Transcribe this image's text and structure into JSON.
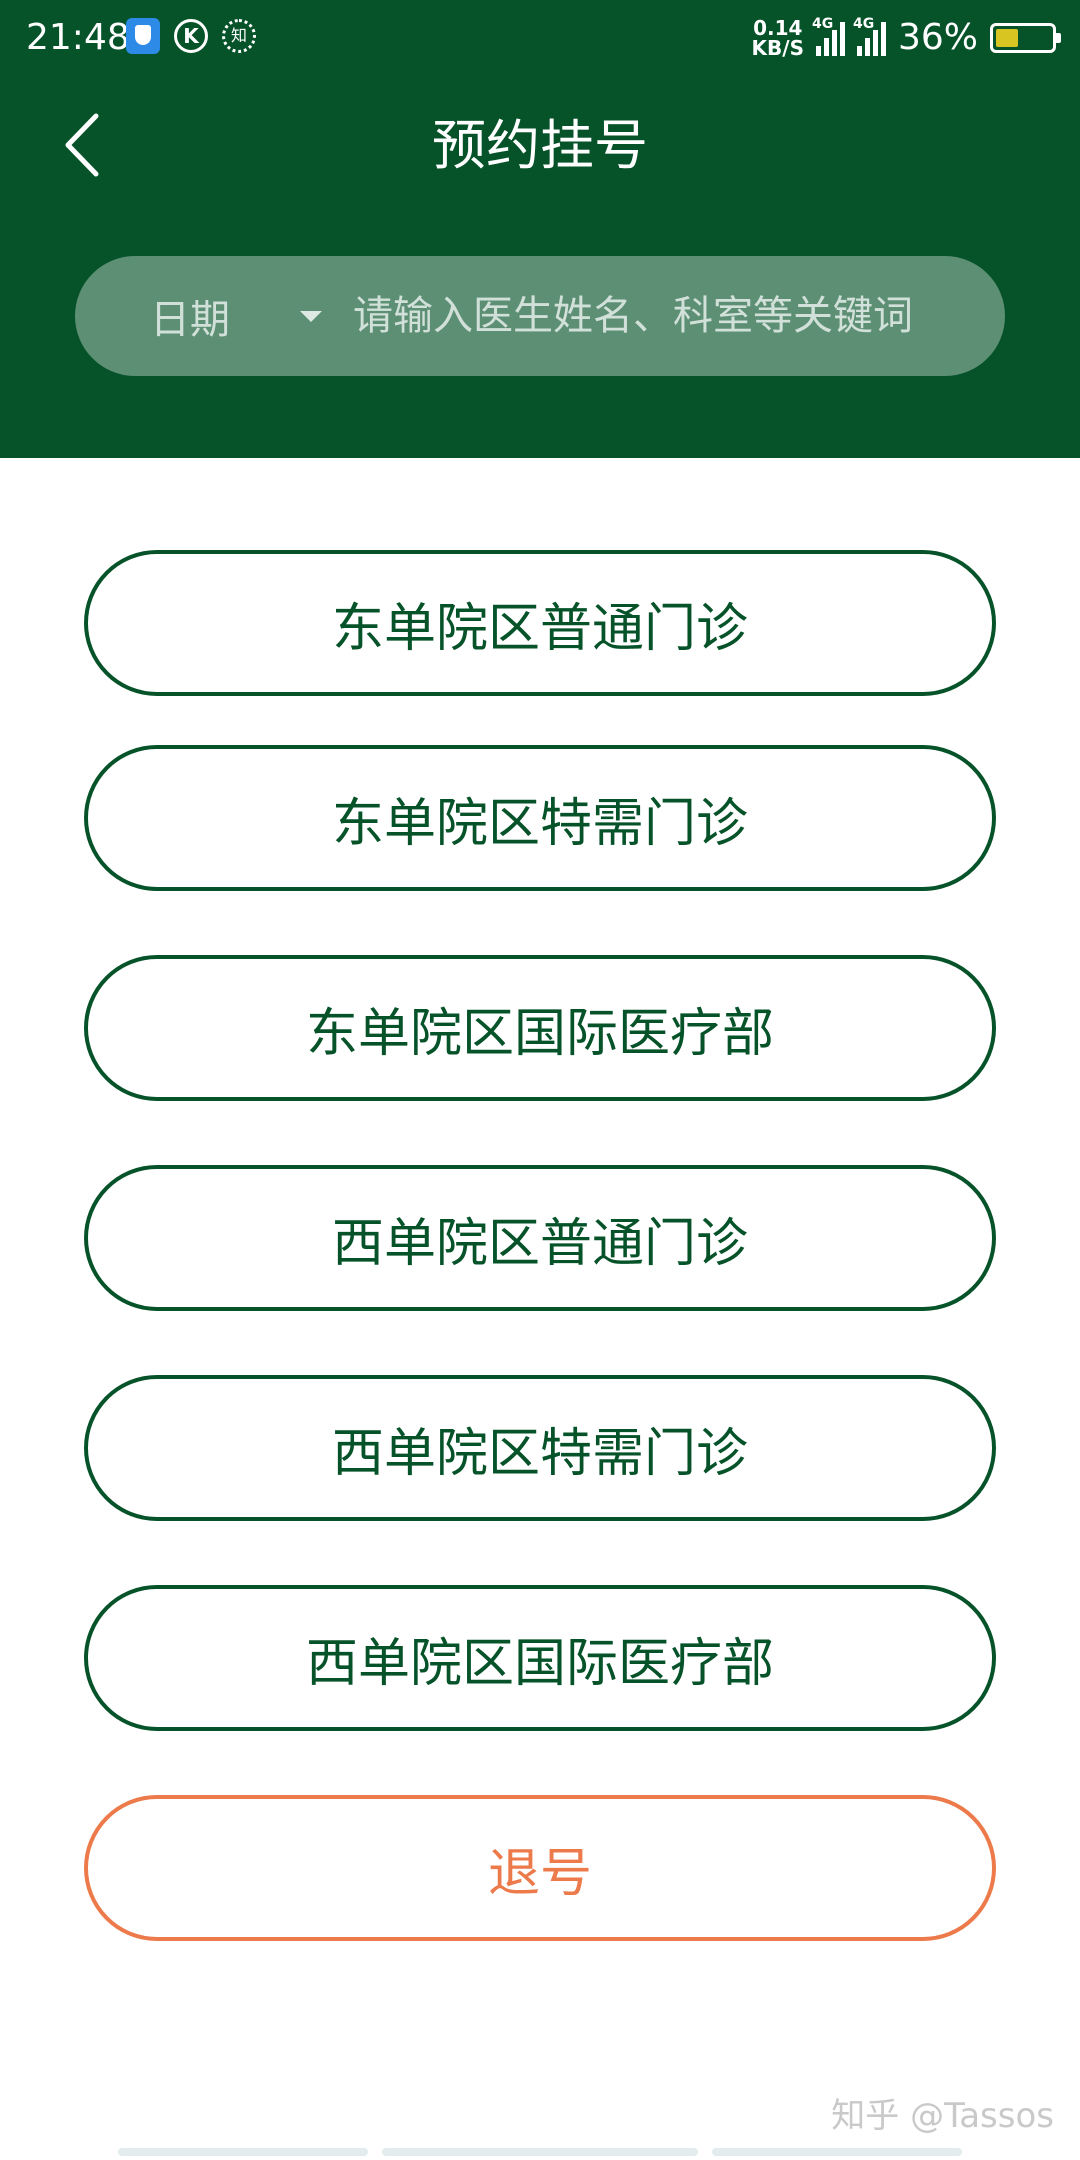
{
  "status_bar": {
    "time": "21:48",
    "net_speed_value": "0.14",
    "net_speed_unit": "KB/S",
    "signal_label_1": "4G",
    "signal_label_2": "4G",
    "battery": "36%",
    "battery_level": 0.36,
    "k_icon_label": "K",
    "zhi_icon_label": "知"
  },
  "header": {
    "title": "预约挂号",
    "background_color": "#06532a"
  },
  "search": {
    "date_label": "日期",
    "placeholder": "请输入医生姓名、科室等关键词"
  },
  "options": [
    {
      "label": "东单院区普通门诊"
    },
    {
      "label": "东单院区特需门诊"
    },
    {
      "label": "东单院区国际医疗部"
    },
    {
      "label": "西单院区普通门诊"
    },
    {
      "label": "西单院区特需门诊"
    },
    {
      "label": "西单院区国际医疗部"
    }
  ],
  "cancel": {
    "label": "退号",
    "color": "#ec7a4a"
  },
  "watermark": "知乎 @Tassos"
}
